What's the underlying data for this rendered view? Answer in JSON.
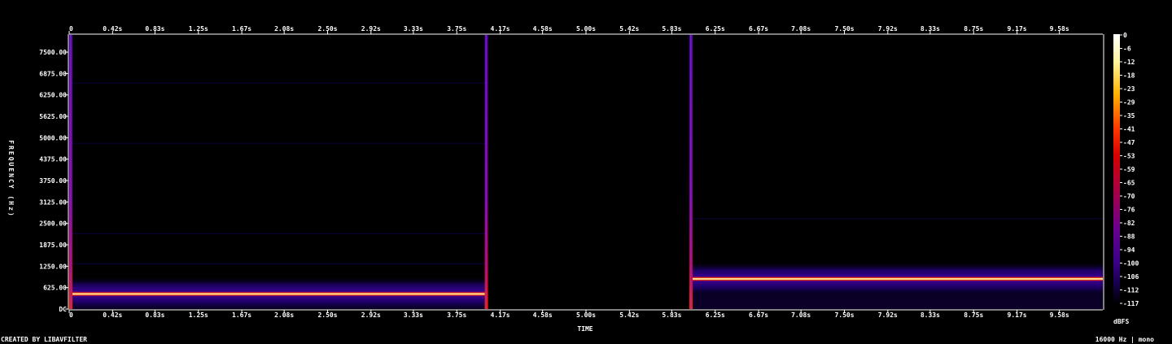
{
  "chart_data": {
    "type": "heatmap",
    "title": "",
    "xlabel": "TIME",
    "ylabel": "FREQUENCY (Hz)",
    "x_unit": "s",
    "xlim": [
      0,
      10
    ],
    "ylim": [
      0,
      8000
    ],
    "x_ticks": [
      "0",
      "0.42s",
      "0.83s",
      "1.25s",
      "1.67s",
      "2.08s",
      "2.50s",
      "2.92s",
      "3.33s",
      "3.75s",
      "4.17s",
      "4.58s",
      "5.00s",
      "5.42s",
      "5.83s",
      "6.25s",
      "6.67s",
      "7.08s",
      "7.50s",
      "7.92s",
      "8.33s",
      "8.75s",
      "9.17s",
      "9.58s"
    ],
    "x_tick_values": [
      0,
      0.42,
      0.83,
      1.25,
      1.67,
      2.08,
      2.5,
      2.92,
      3.33,
      3.75,
      4.17,
      4.58,
      5.0,
      5.42,
      5.83,
      6.25,
      6.67,
      7.08,
      7.5,
      7.92,
      8.33,
      8.75,
      9.17,
      9.58
    ],
    "y_ticks": [
      "DC",
      "625.00",
      "1250.00",
      "1875.00",
      "2500.00",
      "3125.00",
      "3750.00",
      "4375.00",
      "5000.00",
      "5625.00",
      "6250.00",
      "6875.00",
      "7500.00"
    ],
    "y_tick_values": [
      0,
      625,
      1250,
      1875,
      2500,
      3125,
      3750,
      4375,
      5000,
      5625,
      6250,
      6875,
      7500
    ],
    "segments": [
      {
        "t_start": 0.0,
        "t_end": 4.02,
        "frequency_hz": 440,
        "peak_dbfs": 0,
        "harmonics_hz": [
          1320,
          2200,
          4840,
          6600
        ]
      },
      {
        "t_start": 6.0,
        "t_end": 10.0,
        "frequency_hz": 880,
        "peak_dbfs": 0,
        "harmonics_hz": [
          2640
        ]
      }
    ],
    "colorbar": {
      "label": "dBFS",
      "ticks": [
        "0",
        "-6",
        "-12",
        "-18",
        "-23",
        "-29",
        "-35",
        "-41",
        "-47",
        "-53",
        "-59",
        "-65",
        "-70",
        "-76",
        "-82",
        "-88",
        "-94",
        "-100",
        "-106",
        "-112",
        "-117"
      ]
    }
  },
  "footer": {
    "credit": "CREATED BY LIBAVFILTER",
    "info": "16000 Hz | mono"
  }
}
